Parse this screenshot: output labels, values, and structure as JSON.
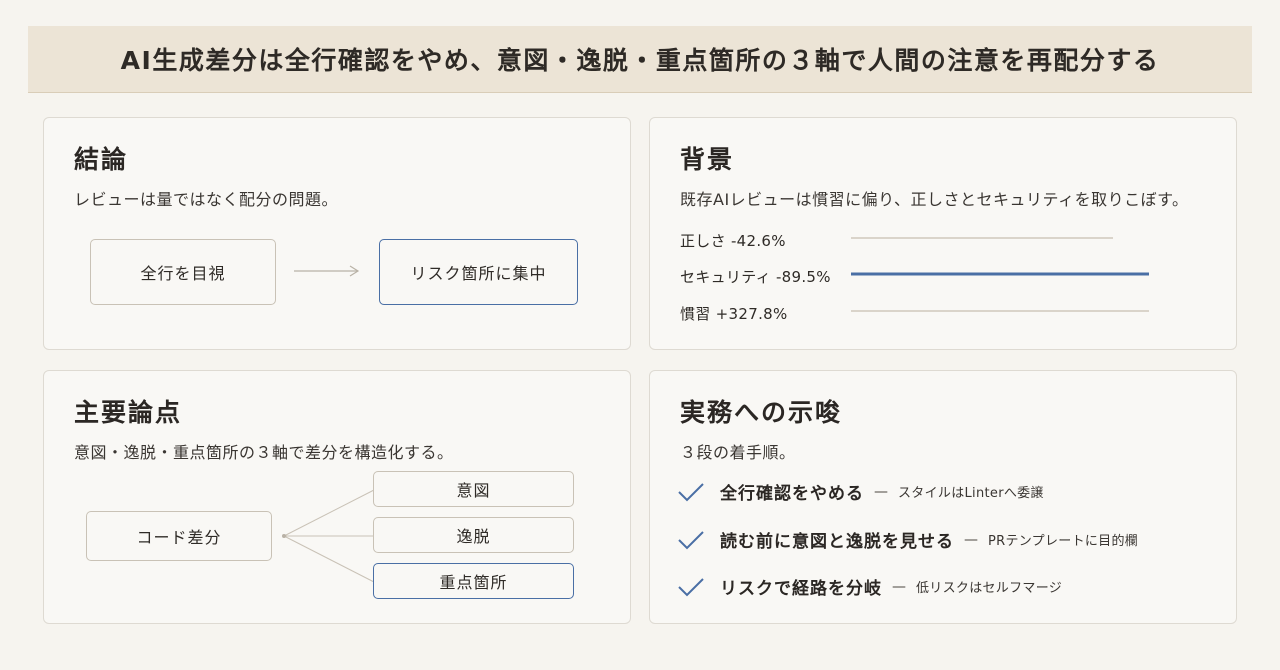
{
  "title": "AI生成差分は全行確認をやめ、意図・逸脱・重点箇所の３軸で人間の注意を再配分する",
  "conclusion": {
    "heading": "結論",
    "subtitle": "レビューは量ではなく配分の問題。",
    "from_box": "全行を目視",
    "to_box": "リスク箇所に集中"
  },
  "background": {
    "heading": "背景",
    "subtitle": "既存AIレビューは慣習に偏り、正しさとセキュリティを取りこぼす。",
    "bars": [
      {
        "label": "正しさ -42.6%",
        "value": -42.6,
        "highlight": false
      },
      {
        "label": "セキュリティ -89.5%",
        "value": -89.5,
        "highlight": true
      },
      {
        "label": "慣習 +327.8%",
        "value": 327.8,
        "highlight": false
      }
    ],
    "colors": {
      "highlight": "#4a6fa5",
      "muted": "#cfc8bb"
    }
  },
  "points": {
    "heading": "主要論点",
    "subtitle": "意図・逸脱・重点箇所の３軸で差分を構造化する。",
    "root": "コード差分",
    "branches": [
      {
        "label": "意図",
        "highlight": false
      },
      {
        "label": "逸脱",
        "highlight": false
      },
      {
        "label": "重点箇所",
        "highlight": true
      }
    ]
  },
  "practice": {
    "heading": "実務への示唆",
    "subtitle": "３段の着手順。",
    "steps": [
      {
        "main": "全行確認をやめる",
        "dash": "—",
        "note": "スタイルはLinterへ委譲"
      },
      {
        "main": "読む前に意図と逸脱を見せる",
        "dash": "—",
        "note": "PRテンプレートに目的欄"
      },
      {
        "main": "リスクで経路を分岐",
        "dash": "—",
        "note": "低リスクはセルフマージ"
      }
    ],
    "check_color": "#4a6fa5"
  },
  "icons": {
    "arrow": "arrow-right-icon",
    "check": "check-icon"
  }
}
